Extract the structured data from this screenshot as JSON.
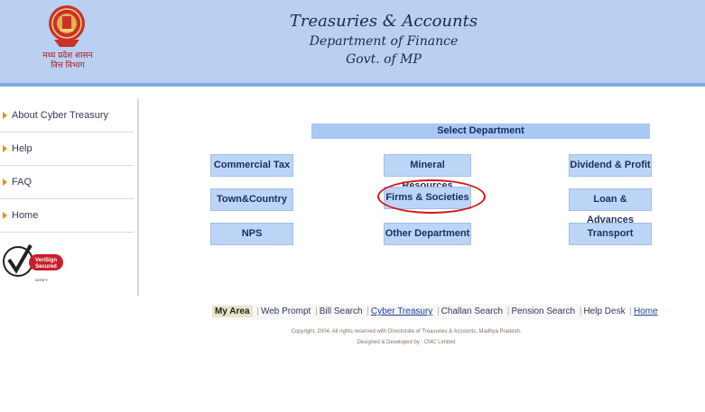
{
  "header": {
    "title": "Treasuries & Accounts",
    "subtitle": "Department of Finance",
    "govt": "Govt. of MP",
    "emblem_caption_1": "मध्य प्रदेश शासन",
    "emblem_caption_2": "वित्त विभाग"
  },
  "sidebar": {
    "items": [
      {
        "label": "About Cyber Treasury"
      },
      {
        "label": "Help"
      },
      {
        "label": "FAQ"
      },
      {
        "label": "Home"
      }
    ],
    "badge_text_1": "VeriSign",
    "badge_text_2": "Secured",
    "badge_text_3": "VERIFY"
  },
  "departments": {
    "heading": "Select Department",
    "items": [
      {
        "label": "Commercial Tax"
      },
      {
        "label": "Mineral Resources"
      },
      {
        "label": "Dividend & Profit"
      },
      {
        "label": "Town&Country"
      },
      {
        "label": "Firms & Societies"
      },
      {
        "label": "Loan & Advances"
      },
      {
        "label": "NPS"
      },
      {
        "label": "Other Department"
      },
      {
        "label": "Transport"
      }
    ]
  },
  "footer_links": {
    "my_area": "My Area",
    "items": [
      {
        "label": "Web Prompt"
      },
      {
        "label": "Bill Search"
      },
      {
        "label": "Cyber Treasury"
      },
      {
        "label": "Challan Search"
      },
      {
        "label": "Pension Search"
      },
      {
        "label": "Help Desk"
      },
      {
        "label": "Home"
      }
    ]
  },
  "copyright": {
    "line1": "Copyright, 2004. All rights reserved with Directorate of Treasuries & Accounts, Madhya Pradesh.",
    "line2": "Designed & Developed by : CMC Limited"
  },
  "colors": {
    "header_bg": "#b9d0f3",
    "button_bg": "#bcd4f6",
    "highlight": "#d01818",
    "arrow": "#f08a00"
  }
}
